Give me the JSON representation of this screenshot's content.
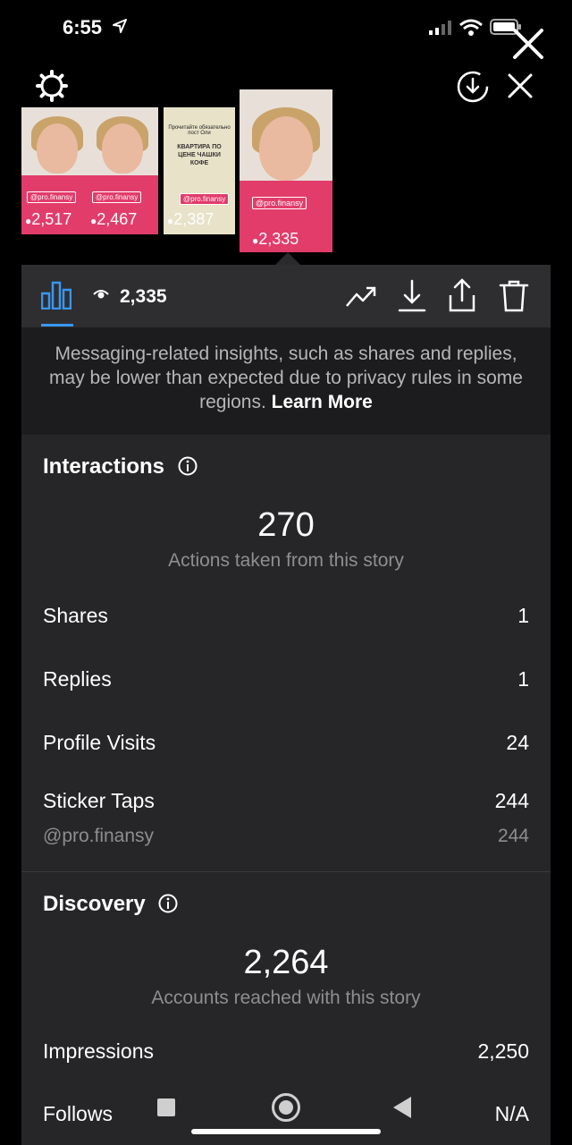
{
  "status_bar": {
    "time": "6:55"
  },
  "stories": [
    {
      "handle": "@pro.finansy",
      "views": "2,517"
    },
    {
      "handle": "@pro.finansy",
      "views": "2,467"
    },
    {
      "handle": "@pro.finansy",
      "views": "2,387",
      "card_title": "КВАРТИРА ПО ЦЕНЕ ЧАШКИ КОФЕ",
      "card_header": "Прочитайте обязательно пост Оли"
    },
    {
      "handle": "@pro.finansy",
      "views": "2,335"
    }
  ],
  "toolbar": {
    "views": "2,335"
  },
  "notice": {
    "text": "Messaging-related insights, such as shares and replies, may be lower than expected due to privacy rules in some regions.",
    "link": "Learn More"
  },
  "interactions": {
    "title": "Interactions",
    "total": "270",
    "caption": "Actions taken from this story",
    "rows": [
      {
        "label": "Shares",
        "value": "1"
      },
      {
        "label": "Replies",
        "value": "1"
      },
      {
        "label": "Profile Visits",
        "value": "24"
      },
      {
        "label": "Sticker Taps",
        "value": "244"
      }
    ],
    "sticker_sub": {
      "label": "@pro.finansy",
      "value": "244"
    }
  },
  "discovery": {
    "title": "Discovery",
    "total": "2,264",
    "caption": "Accounts reached with this story",
    "rows": [
      {
        "label": "Impressions",
        "value": "2,250"
      },
      {
        "label": "Follows",
        "value": "N/A"
      }
    ]
  },
  "colors": {
    "accent": "#3897f0",
    "panel": "#262628",
    "notice_bg": "#1c1c1e",
    "story_pink": "#e23c6b"
  }
}
